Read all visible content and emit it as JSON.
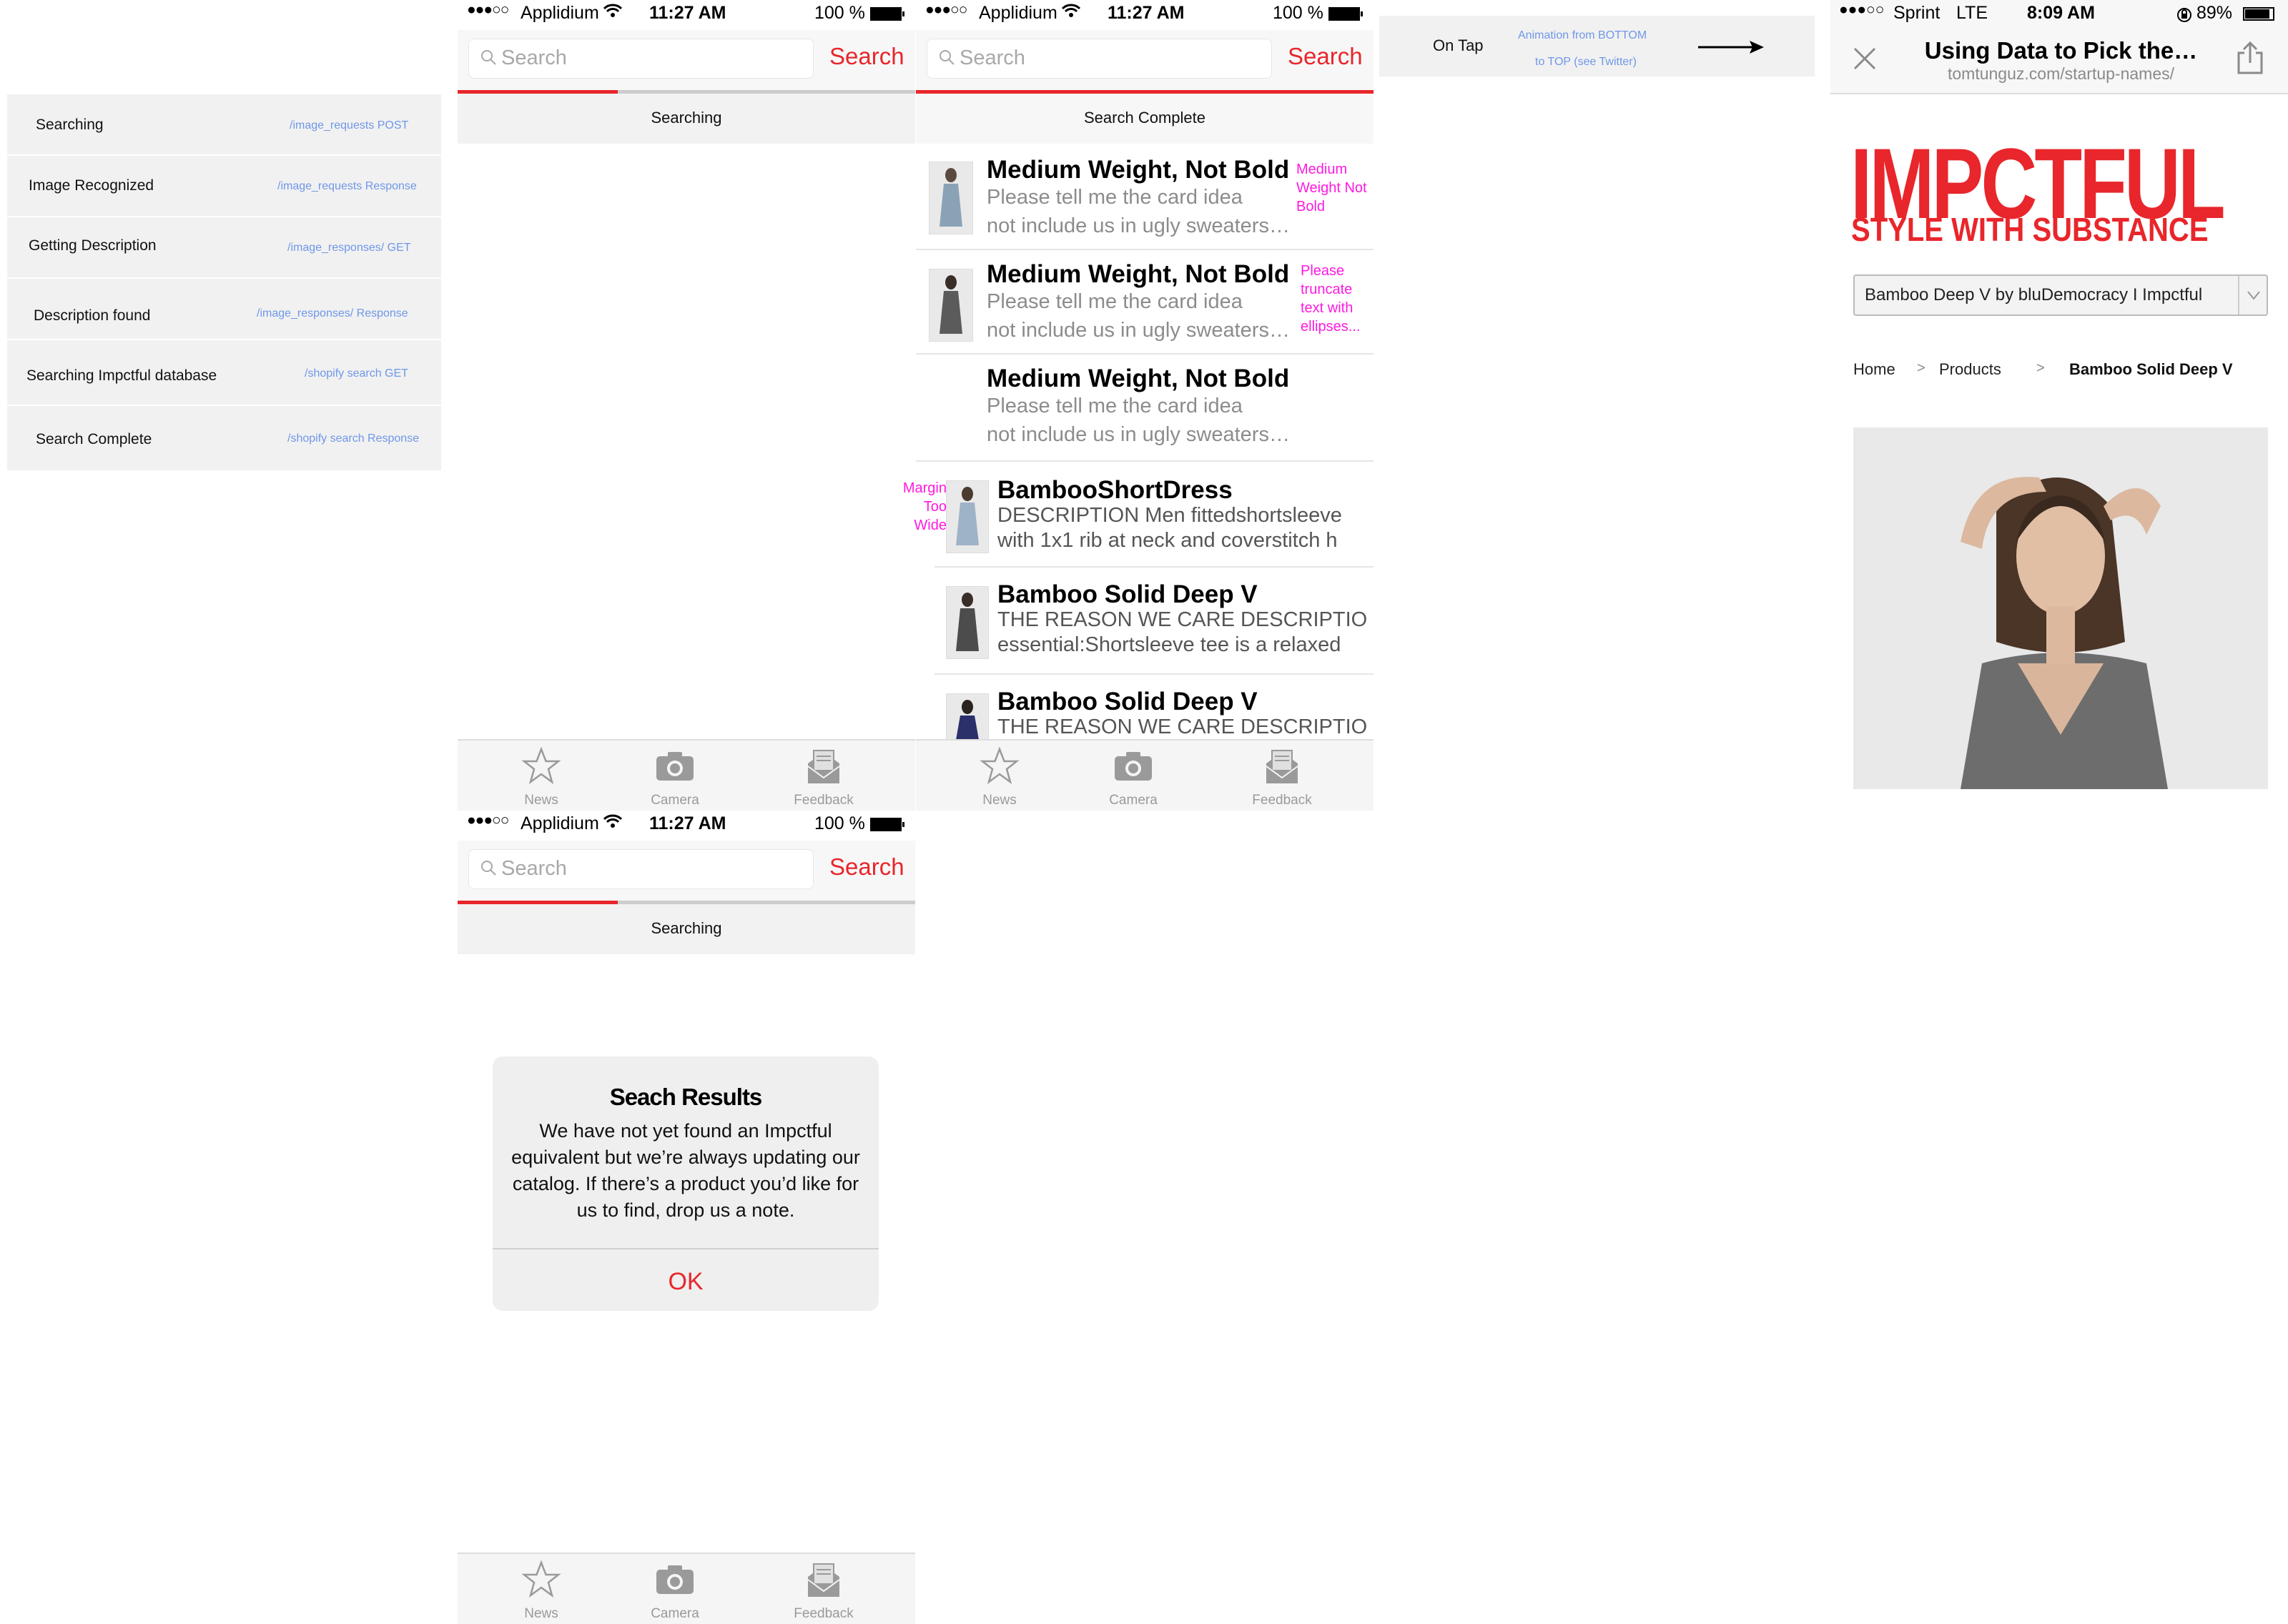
{
  "status_steps": [
    {
      "label": "Searching",
      "endpoint": "/image_requests POST"
    },
    {
      "label": "Image Recognized",
      "endpoint": "/image_requests Response"
    },
    {
      "label": "Getting Description",
      "endpoint": "/image_responses/ GET"
    },
    {
      "label": "Description found",
      "endpoint": "/image_responses/ Response"
    },
    {
      "label": "Searching Impctful database",
      "endpoint": "/shopify search GET"
    },
    {
      "label": "Search Complete",
      "endpoint": "/shopify search Response"
    }
  ],
  "app_status_bar": {
    "carrier": "Applidium",
    "time": "11:27 AM",
    "battery": "100 %"
  },
  "search": {
    "placeholder": "Search",
    "button": "Search"
  },
  "states": {
    "searching": "Searching",
    "complete": "Search Complete"
  },
  "tabs": [
    {
      "label": "News",
      "icon": "star-icon"
    },
    {
      "label": "Camera",
      "icon": "camera-icon"
    },
    {
      "label": "Feedback",
      "icon": "feedback-envelope-icon"
    }
  ],
  "progress": {
    "searching_fraction": 0.35,
    "complete_fraction": 1.0
  },
  "results": [
    {
      "title": "Medium Weight, Not Bold",
      "line1": "Please tell me the card idea",
      "line2": "not include us in ugly sweaters…",
      "note": "Medium Weight Not Bold"
    },
    {
      "title": "Medium Weight, Not Bold",
      "line1": "Please tell me the card idea",
      "line2": "not include us in ugly sweaters…",
      "note": "Please truncate text with ellipses..."
    },
    {
      "title": "Medium Weight, Not Bold",
      "line1": "Please tell me the card idea",
      "line2": "not include us in ugly sweaters…"
    },
    {
      "title": "BambooShortDress",
      "line1": "DESCRIPTION Men fittedshortsleeve",
      "line2": "with 1x1 rib at neck and coverstitch h",
      "note": "Margin Too Wide"
    },
    {
      "title": "Bamboo Solid Deep V",
      "line1": "THE REASON WE CARE DESCRIPTIO",
      "line2": "essential:Shortsleeve tee is a relaxed"
    },
    {
      "title": "Bamboo Solid Deep V",
      "line1": "THE REASON WE CARE DESCRIPTIO",
      "line2": ""
    }
  ],
  "alert": {
    "title": "Seach Results",
    "message": "We have not yet found an Impctful equivalent but we’re always updating our catalog. If there’s a product you’d like for us to find, drop us a note.",
    "ok": "OK"
  },
  "on_tap": {
    "label": "On Tap",
    "note_line1": "Animation from BOTTOM",
    "note_line2": "to TOP (see Twitter)",
    "arrow": "right-arrow-icon"
  },
  "browser": {
    "status": {
      "carrier": "Sprint",
      "network": "LTE",
      "time": "8:09 AM",
      "battery": "89%"
    },
    "title": "Using Data to Pick the…",
    "url": "tomtunguz.com/startup-names/",
    "logo_main": "IMPCTFUL",
    "logo_tagline": "STYLE WITH SUBSTANCE",
    "dropdown_value": "Bamboo Deep V by bluDemocracy I Impctful",
    "breadcrumb": [
      "Home",
      "Products",
      "Bamboo Solid Deep V"
    ],
    "breadcrumb_separator": ">"
  },
  "colors": {
    "accent": "#e8262b",
    "annotation": "#ff19e0",
    "endpoint": "#6f97e8",
    "panel": "#f1f1f1"
  }
}
